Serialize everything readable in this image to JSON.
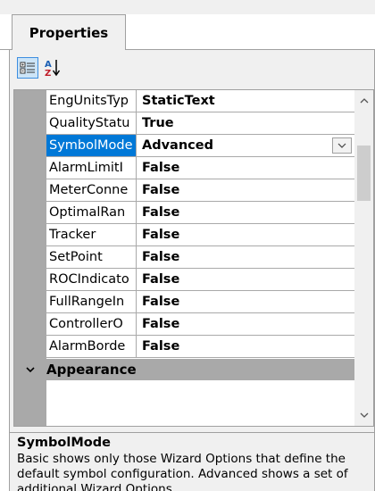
{
  "tabs": [
    {
      "label": "Properties"
    }
  ],
  "toolbar": {
    "categorized_icon": "categorized-view-icon",
    "alphabetical_icon": "alphabetical-sort-icon"
  },
  "properties": [
    {
      "name": "EngUnitsTyp",
      "value": "StaticText"
    },
    {
      "name": "QualityStatu",
      "value": "True"
    },
    {
      "name": "SymbolMode",
      "value": "Advanced"
    },
    {
      "name": "AlarmLimitI",
      "value": "False"
    },
    {
      "name": "MeterConne",
      "value": "False"
    },
    {
      "name": "OptimalRan",
      "value": "False"
    },
    {
      "name": "Tracker",
      "value": "False"
    },
    {
      "name": "SetPoint",
      "value": "False"
    },
    {
      "name": "ROCIndicato",
      "value": "False"
    },
    {
      "name": "FullRangeIn",
      "value": "False"
    },
    {
      "name": "ControllerO",
      "value": "False"
    },
    {
      "name": "AlarmBorde",
      "value": "False"
    }
  ],
  "category": {
    "label": "Appearance"
  },
  "help": {
    "title": "SymbolMode",
    "description": "Basic shows only those Wizard Options that define the default symbol configuration. Advanced shows a set of additional Wizard Options."
  },
  "colors": {
    "selection": "#0078d7",
    "margin": "#a9a9a9"
  }
}
